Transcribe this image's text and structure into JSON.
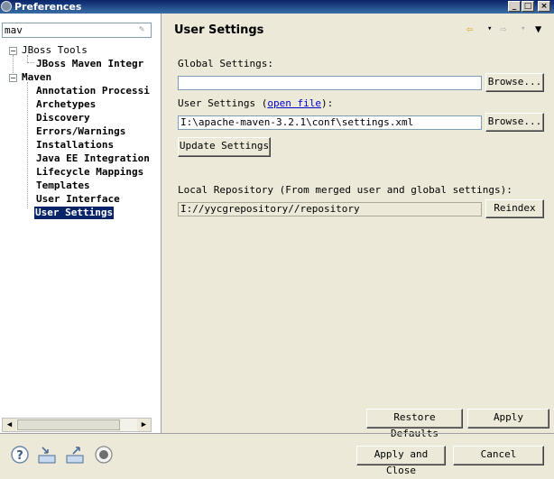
{
  "window": {
    "title": "Preferences"
  },
  "filter": {
    "value": "mav"
  },
  "tree": {
    "items": [
      {
        "label": "JBoss Tools"
      },
      {
        "label": "JBoss Maven Integr"
      },
      {
        "label": "Maven"
      },
      {
        "label": "Annotation Processi"
      },
      {
        "label": "Archetypes"
      },
      {
        "label": "Discovery"
      },
      {
        "label": "Errors/Warnings"
      },
      {
        "label": "Installations"
      },
      {
        "label": "Java EE Integration"
      },
      {
        "label": "Lifecycle Mappings"
      },
      {
        "label": "Templates"
      },
      {
        "label": "User Interface"
      },
      {
        "label": "User Settings"
      }
    ]
  },
  "page": {
    "title": "User Settings",
    "global_settings_label": "Global Settings:",
    "global_settings_value": "",
    "user_settings_label": "User Settings (",
    "open_file_link": "open file",
    "user_settings_label_end": "):",
    "user_settings_value": "I:\\apache-maven-3.2.1\\conf\\settings.xml",
    "browse_label": "Browse...",
    "update_settings_label": "Update Settings",
    "local_repo_label": "Local Repository (From merged user and global settings):",
    "local_repo_value": "I://yycgrepository//repository",
    "reindex_label": "Reindex",
    "restore_defaults_label": "Restore Defaults",
    "apply_label": "Apply"
  },
  "footer": {
    "apply_close_label": "Apply and Close",
    "cancel_label": "Cancel"
  },
  "colors": {
    "titlebar": "#0a246a",
    "selection": "#0a246a",
    "link": "#0000cc",
    "dialog_bg": "#ece9d8"
  },
  "icons": [
    "help-icon",
    "import-icon",
    "export-icon",
    "record-icon",
    "back-icon",
    "forward-icon",
    "menu-icon"
  ]
}
